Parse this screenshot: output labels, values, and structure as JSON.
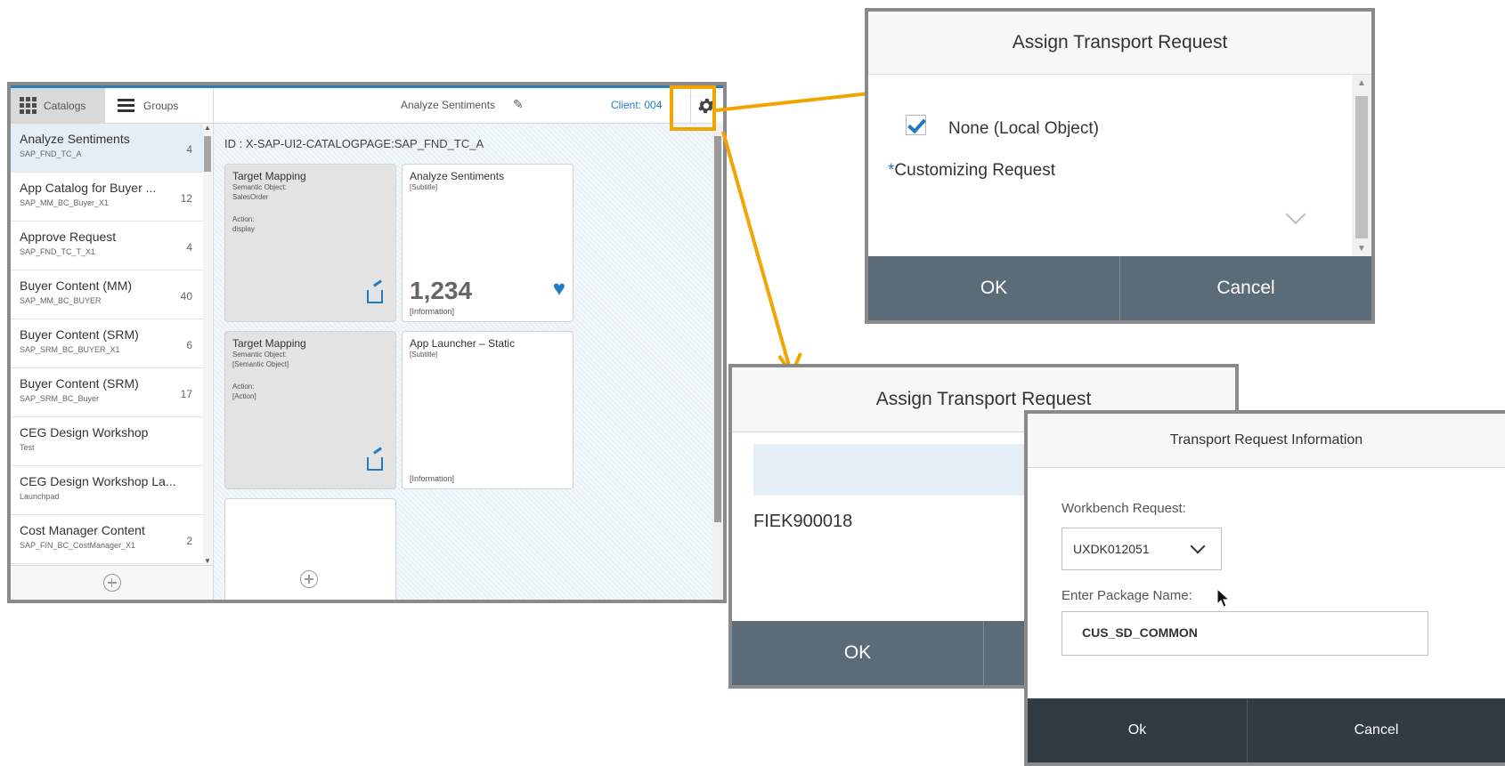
{
  "main": {
    "tabs": {
      "catalogs": "Catalogs",
      "groups": "Groups"
    },
    "catalogs": [
      {
        "title": "Analyze Sentiments",
        "subtitle": "SAP_FND_TC_A",
        "count": "4"
      },
      {
        "title": "App Catalog for Buyer ...",
        "subtitle": "SAP_MM_BC_Buyer_X1",
        "count": "12"
      },
      {
        "title": "Approve Request",
        "subtitle": "SAP_FND_TC_T_X1",
        "count": "4"
      },
      {
        "title": "Buyer Content (MM)",
        "subtitle": "SAP_MM_BC_BUYER",
        "count": "40"
      },
      {
        "title": "Buyer Content (SRM)",
        "subtitle": "SAP_SRM_BC_BUYER_X1",
        "count": "6"
      },
      {
        "title": "Buyer Content (SRM)",
        "subtitle": "SAP_SRM_BC_Buyer",
        "count": "17"
      },
      {
        "title": "CEG Design Workshop",
        "subtitle": "Test",
        "count": ""
      },
      {
        "title": "CEG Design Workshop La...",
        "subtitle": "Launchpad",
        "count": ""
      },
      {
        "title": "Cost Manager Content",
        "subtitle": "SAP_FIN_BC_CostManager_X1",
        "count": "2"
      }
    ],
    "header": {
      "page_name": "Analyze Sentiments",
      "client": "Client: 004"
    },
    "page_id": "ID : X-SAP-UI2-CATALOGPAGE:SAP_FND_TC_A",
    "tiles": {
      "map1": {
        "title": "Target Mapping",
        "l1": "Semantic Object:",
        "l2": "SalesOrder",
        "l3": "Action:",
        "l4": "display"
      },
      "app1": {
        "title": "Analyze Sentiments",
        "subtitle": "[Subtitle]",
        "number": "1,234",
        "info": "[Information]"
      },
      "map2": {
        "title": "Target Mapping",
        "l1": "Semantic Object:",
        "l2": "[Semantic Object]",
        "l3": "Action:",
        "l4": "[Action]"
      },
      "app2": {
        "title": "App Launcher – Static",
        "subtitle": "[Subtitle]",
        "info": "[Information]"
      }
    }
  },
  "dialog1": {
    "title": "Assign Transport Request",
    "none_label": "None (Local Object)",
    "required_mark": "*",
    "customizing_label": "Customizing Request",
    "ok": "OK",
    "cancel": "Cancel"
  },
  "dialog2": {
    "title": "Assign Transport Request",
    "request": "FIEK900018",
    "ok": "OK"
  },
  "dialog3": {
    "title": "Transport Request Information",
    "workbench_label": "Workbench Request:",
    "workbench_value": "UXDK012051",
    "package_label": "Enter Package Name:",
    "package_value": "CUS_SD_COMMON",
    "ok": "Ok",
    "cancel": "Cancel"
  },
  "colors": {
    "accent": "#f0a500",
    "brand_blue": "#1f7bc4",
    "footer_gray": "#5c6b78"
  }
}
